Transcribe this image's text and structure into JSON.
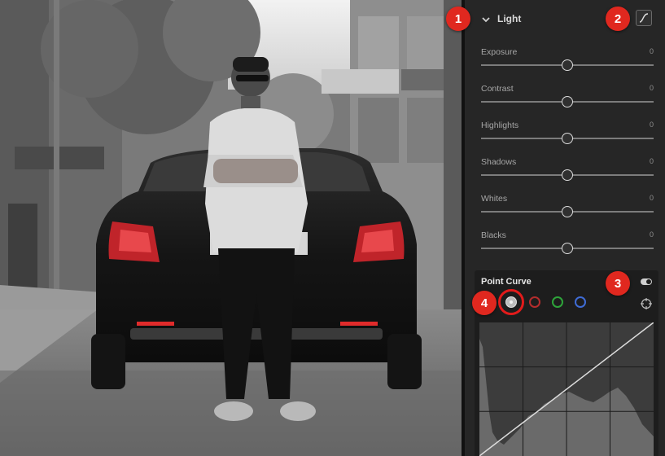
{
  "photo": {
    "alt": "Man in white t-shirt standing with crossed arms in front of a black sedan on a cobblestone street; selective color on red taillights"
  },
  "panel": {
    "light": {
      "title": "Light",
      "collapse_icon": "chevron-down-icon",
      "curve_icon": "tone-curve-icon"
    },
    "sliders": [
      {
        "label": "Exposure",
        "value": "0",
        "position_fraction": 0.5
      },
      {
        "label": "Contrast",
        "value": "0",
        "position_fraction": 0.5
      },
      {
        "label": "Highlights",
        "value": "0",
        "position_fraction": 0.5
      },
      {
        "label": "Shadows",
        "value": "0",
        "position_fraction": 0.5
      },
      {
        "label": "Whites",
        "value": "0",
        "position_fraction": 0.5
      },
      {
        "label": "Blacks",
        "value": "0",
        "position_fraction": 0.5
      }
    ],
    "point_curve": {
      "title": "Point Curve",
      "toggle_on": true,
      "channels": [
        "rgb",
        "red",
        "green",
        "blue"
      ],
      "channel_colors": {
        "rgb": "#bdbdbd",
        "red": "#b42d2d",
        "green": "#2ea43a",
        "blue": "#3f6cd6"
      },
      "selected_channel": "rgb",
      "target_icon": "target-adjustment-icon"
    }
  },
  "callouts": [
    "1",
    "2",
    "3",
    "4"
  ],
  "colors": {
    "callout": "#e0281f",
    "panel_bg": "#262626",
    "curve_bg": "#1d1d1d"
  }
}
